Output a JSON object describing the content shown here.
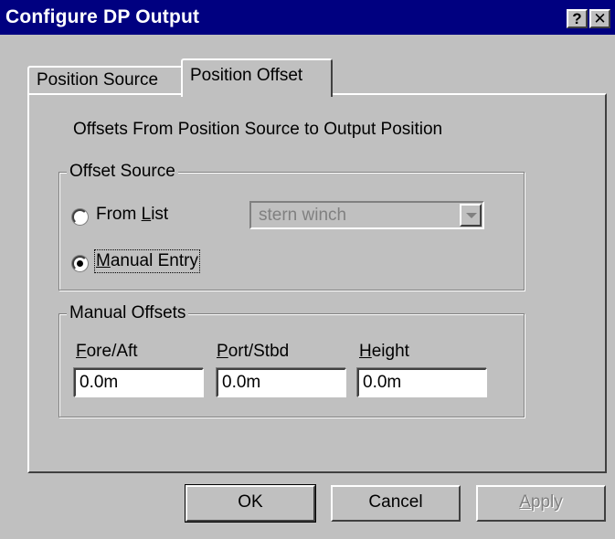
{
  "window": {
    "title": "Configure DP Output",
    "help_glyph": "?",
    "close_glyph": "✕"
  },
  "tabs": [
    {
      "label": "Position Source",
      "active": false
    },
    {
      "label": "Position Offset",
      "active": true
    }
  ],
  "panel": {
    "description": "Offsets From Position Source to Output Position",
    "offset_source": {
      "label": "Offset Source",
      "options": [
        {
          "label_prefix": "From ",
          "label_access": "L",
          "label_suffix": "ist",
          "selected": false
        },
        {
          "label_prefix": "",
          "label_access": "M",
          "label_suffix": "anual Entry",
          "selected": true
        }
      ],
      "list_combo": {
        "value": "stern winch",
        "disabled": true
      }
    },
    "manual_offsets": {
      "label": "Manual Offsets",
      "fields": [
        {
          "label_access": "F",
          "label_rest": "ore/Aft",
          "value": "0.0m"
        },
        {
          "label_access": "P",
          "label_rest": "ort/Stbd",
          "value": "0.0m"
        },
        {
          "label_access": "H",
          "label_rest": "eight",
          "value": "0.0m"
        }
      ]
    }
  },
  "buttons": {
    "ok": "OK",
    "cancel": "Cancel",
    "apply_access": "A",
    "apply_rest": "pply"
  }
}
